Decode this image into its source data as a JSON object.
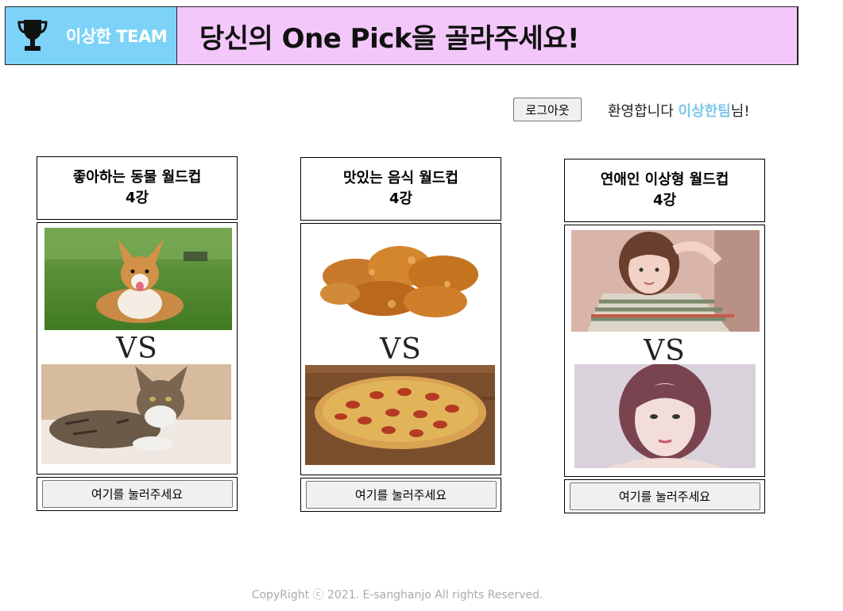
{
  "header": {
    "team_name": "이상한 TEAM",
    "title": "당신의 One Pick을 골라주세요!",
    "accent_color": "#7dd3f7",
    "title_bg_color": "#f4c7fb"
  },
  "user_bar": {
    "logout_label": "로그아웃",
    "welcome_prefix": "환영합니다 ",
    "username": "이상한팀",
    "welcome_suffix": "님!"
  },
  "cards": [
    {
      "title_line1": "좋아하는 동물 월드컵",
      "title_line2": "4강",
      "vs": "VS",
      "image_top": "corgi-dog-photo",
      "image_bottom": "tabby-cat-photo",
      "button_label": "여기를 눌러주세요"
    },
    {
      "title_line1": "맛있는 음식 월드컵",
      "title_line2": "4강",
      "vs": "VS",
      "image_top": "fried-chicken-photo",
      "image_bottom": "pepperoni-pizza-photo",
      "button_label": "여기를 눌러주세요"
    },
    {
      "title_line1": "연애인 이상형 월드컵",
      "title_line2": "4강",
      "vs": "VS",
      "image_top": "woman-striped-shirt-photo",
      "image_bottom": "woman-portrait-photo",
      "button_label": "여기를 눌러주세요"
    }
  ],
  "footer": {
    "text": "CopyRight  ⓒ 2021. E-sanghanjo  All rights Reserved."
  }
}
